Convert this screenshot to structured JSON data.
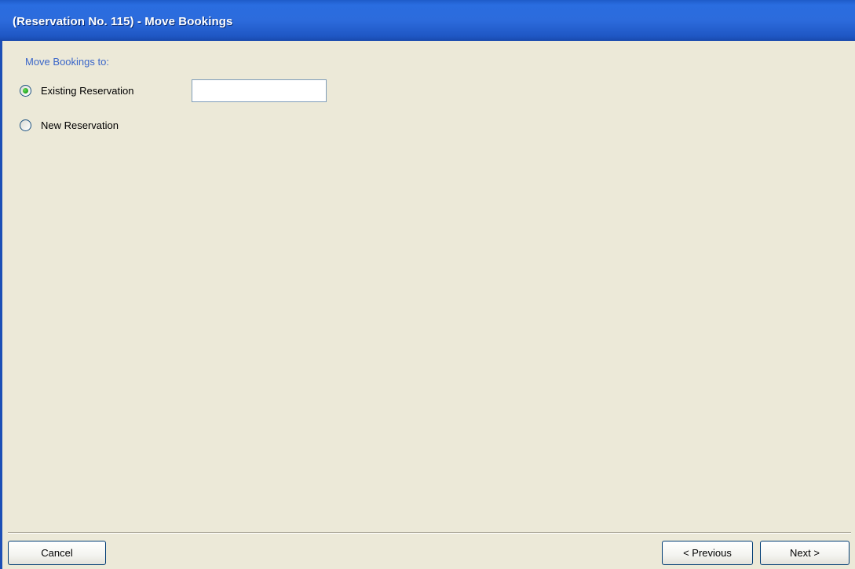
{
  "window": {
    "title": "(Reservation No. 115) - Move Bookings"
  },
  "form": {
    "section_label": "Move Bookings to:",
    "options": [
      {
        "label": "Existing Reservation",
        "selected": true
      },
      {
        "label": "New Reservation",
        "selected": false
      }
    ],
    "existing_reservation_value": ""
  },
  "footer": {
    "cancel_label": "Cancel",
    "previous_label": "< Previous",
    "next_label": "Next >"
  },
  "colors": {
    "titlebar": "#2a6de0",
    "background": "#ece9d8",
    "section_label": "#3a66c9",
    "radio_selected": "#21a121"
  }
}
